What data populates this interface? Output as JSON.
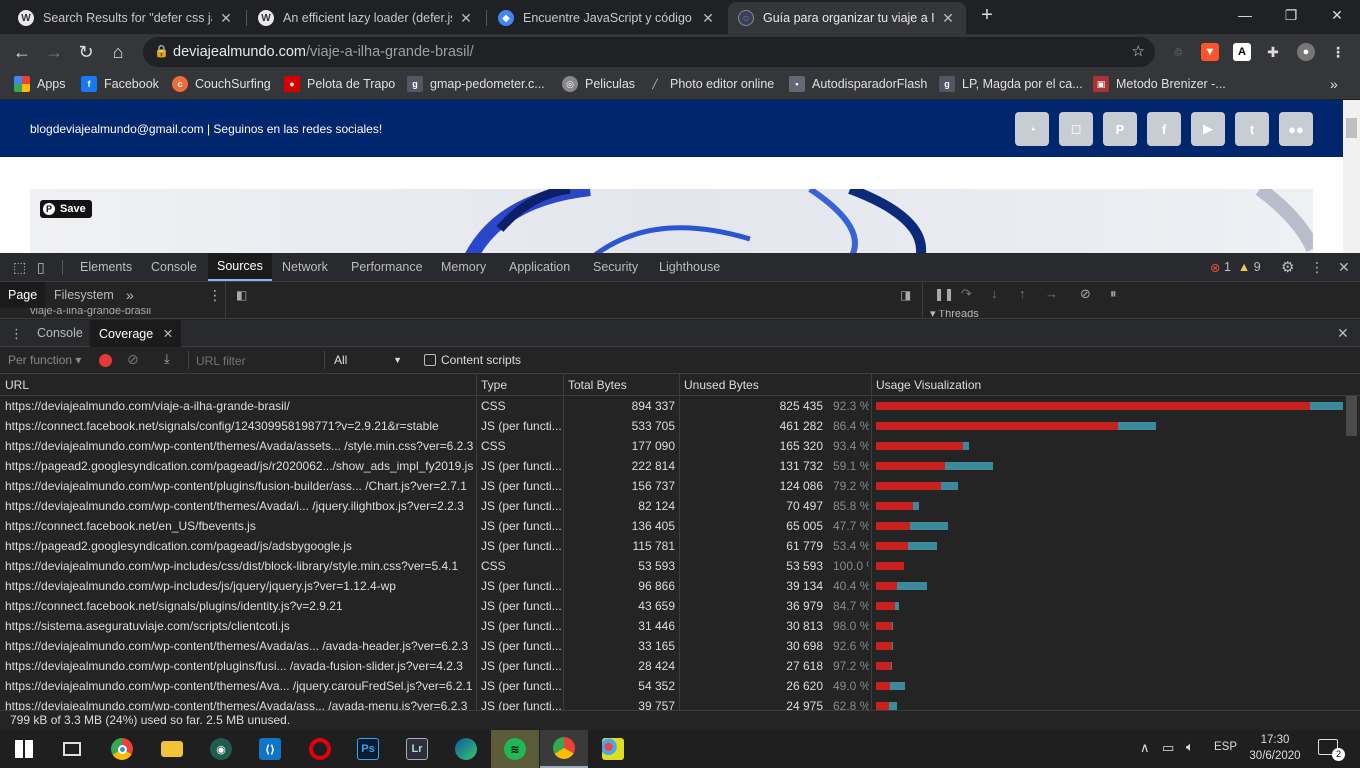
{
  "browser": {
    "tabs": [
      {
        "title": "Search Results for \"defer css javascript\"",
        "favicon": "wordpress-icon"
      },
      {
        "title": "An efficient lazy loader (defer.js)",
        "favicon": "wordpress-icon"
      },
      {
        "title": "Encuentre JavaScript y código CSS",
        "favicon": "chrome-devtools-icon"
      },
      {
        "title": "Guía para organizar tu viaje a Ilha Grande",
        "favicon": "site-icon"
      }
    ],
    "new_tab": "+",
    "url_host": "deviajealmundo.com",
    "url_path": "/viaje-a-ilha-grande-brasil/",
    "bookmarks": [
      {
        "label": "Apps",
        "color": "#e53935",
        "icon": "apps-icon"
      },
      {
        "label": "Facebook",
        "color": "#1877f2",
        "icon": "facebook-icon"
      },
      {
        "label": "CouchSurfing",
        "color": "#ed6b3a",
        "icon": "couchsurfing-icon"
      },
      {
        "label": "Pelota de Trapo",
        "color": "#d90000",
        "icon": "pelota-icon"
      },
      {
        "label": "gmap-pedometer.c...",
        "color": "#556",
        "icon": "gmap-icon"
      },
      {
        "label": "Peliculas",
        "color": "#888",
        "icon": "peliculas-icon"
      },
      {
        "label": "Photo editor online",
        "color": "#777",
        "icon": "photo-editor-icon"
      },
      {
        "label": "AutodisparadorFlash",
        "color": "#667",
        "icon": "flash-icon"
      },
      {
        "label": "LP, Magda por el ca...",
        "color": "#556",
        "icon": "lp-icon"
      },
      {
        "label": "Metodo Brenizer -...",
        "color": "#a33",
        "icon": "brenizer-icon"
      }
    ]
  },
  "site": {
    "topbar_text": "blogdeviajealmundo@gmail.com  |  Seguinos en las redes sociales!",
    "social_icons": [
      "rss-icon",
      "instagram-icon",
      "pinterest-icon",
      "facebook-icon",
      "youtube-icon",
      "twitter-icon",
      "flickr-icon"
    ],
    "pin_save": "Save"
  },
  "devtools": {
    "tabs": [
      "Elements",
      "Console",
      "Sources",
      "Network",
      "Performance",
      "Memory",
      "Application",
      "Security",
      "Lighthouse"
    ],
    "active_tab": "Sources",
    "errors": "1",
    "warnings": "9",
    "sources_tabs": [
      "Page",
      "Filesystem"
    ],
    "sources_tree_item": "viaje-a-ilha-grande-brasil",
    "threads_label": "Threads",
    "drawer_tabs": [
      "Console",
      "Coverage"
    ],
    "coverage": {
      "mode": "Per function",
      "url_filter_placeholder": "URL filter",
      "type_filter": "All",
      "content_scripts_label": "Content scripts",
      "columns": [
        "URL",
        "Type",
        "Total Bytes",
        "Unused Bytes",
        "Usage Visualization"
      ],
      "rows": [
        {
          "url": "https://deviajealmundo.com/viaje-a-ilha-grande-brasil/",
          "type": "CSS",
          "total": "894 337",
          "unused": "825 435",
          "pct": "92.3 %",
          "total_n": 894337,
          "unused_n": 825435
        },
        {
          "url": "https://connect.facebook.net/signals/config/124309958198771?v=2.9.21&r=stable",
          "type": "JS (per functi...",
          "total": "533 705",
          "unused": "461 282",
          "pct": "86.4 %",
          "total_n": 533705,
          "unused_n": 461282
        },
        {
          "url": "https://deviajealmundo.com/wp-content/themes/Avada/assets... /style.min.css?ver=6.2.3",
          "type": "CSS",
          "total": "177 090",
          "unused": "165 320",
          "pct": "93.4 %",
          "total_n": 177090,
          "unused_n": 165320
        },
        {
          "url": "https://pagead2.googlesyndication.com/pagead/js/r2020062.../show_ads_impl_fy2019.js",
          "type": "JS (per functi...",
          "total": "222 814",
          "unused": "131 732",
          "pct": "59.1 %",
          "total_n": 222814,
          "unused_n": 131732
        },
        {
          "url": "https://deviajealmundo.com/wp-content/plugins/fusion-builder/ass... /Chart.js?ver=2.7.1",
          "type": "JS (per functi...",
          "total": "156 737",
          "unused": "124 086",
          "pct": "79.2 %",
          "total_n": 156737,
          "unused_n": 124086
        },
        {
          "url": "https://deviajealmundo.com/wp-content/themes/Avada/i... /jquery.ilightbox.js?ver=2.2.3",
          "type": "JS (per functi...",
          "total": "82 124",
          "unused": "70 497",
          "pct": "85.8 %",
          "total_n": 82124,
          "unused_n": 70497
        },
        {
          "url": "https://connect.facebook.net/en_US/fbevents.js",
          "type": "JS (per functi...",
          "total": "136 405",
          "unused": "65 005",
          "pct": "47.7 %",
          "total_n": 136405,
          "unused_n": 65005
        },
        {
          "url": "https://pagead2.googlesyndication.com/pagead/js/adsbygoogle.js",
          "type": "JS (per functi...",
          "total": "115 781",
          "unused": "61 779",
          "pct": "53.4 %",
          "total_n": 115781,
          "unused_n": 61779
        },
        {
          "url": "https://deviajealmundo.com/wp-includes/css/dist/block-library/style.min.css?ver=5.4.1",
          "type": "CSS",
          "total": "53 593",
          "unused": "53 593",
          "pct": "100.0 %",
          "total_n": 53593,
          "unused_n": 53593
        },
        {
          "url": "https://deviajealmundo.com/wp-includes/js/jquery/jquery.js?ver=1.12.4-wp",
          "type": "JS (per functi...",
          "total": "96 866",
          "unused": "39 134",
          "pct": "40.4 %",
          "total_n": 96866,
          "unused_n": 39134
        },
        {
          "url": "https://connect.facebook.net/signals/plugins/identity.js?v=2.9.21",
          "type": "JS (per functi...",
          "total": "43 659",
          "unused": "36 979",
          "pct": "84.7 %",
          "total_n": 43659,
          "unused_n": 36979
        },
        {
          "url": "https://sistema.aseguratuviaje.com/scripts/clientcoti.js",
          "type": "JS (per functi...",
          "total": "31 446",
          "unused": "30 813",
          "pct": "98.0 %",
          "total_n": 31446,
          "unused_n": 30813
        },
        {
          "url": "https://deviajealmundo.com/wp-content/themes/Avada/as... /avada-header.js?ver=6.2.3",
          "type": "JS (per functi...",
          "total": "33 165",
          "unused": "30 698",
          "pct": "92.6 %",
          "total_n": 33165,
          "unused_n": 30698
        },
        {
          "url": "https://deviajealmundo.com/wp-content/plugins/fusi... /avada-fusion-slider.js?ver=4.2.3",
          "type": "JS (per functi...",
          "total": "28 424",
          "unused": "27 618",
          "pct": "97.2 %",
          "total_n": 28424,
          "unused_n": 27618
        },
        {
          "url": "https://deviajealmundo.com/wp-content/themes/Ava... /jquery.carouFredSel.js?ver=6.2.1",
          "type": "JS (per functi...",
          "total": "54 352",
          "unused": "26 620",
          "pct": "49.0 %",
          "total_n": 54352,
          "unused_n": 26620
        },
        {
          "url": "https://deviajealmundo.com/wp-content/themes/Avada/ass... /avada-menu.js?ver=6.2.3",
          "type": "JS (per functi...",
          "total": "39 757",
          "unused": "24 975",
          "pct": "62.8 %",
          "total_n": 39757,
          "unused_n": 24975
        }
      ],
      "status": "799 kB of 3.3 MB (24%) used so far. 2.5 MB unused."
    }
  },
  "taskbar": {
    "lang": "ESP",
    "time": "17:30",
    "date": "30/6/2020",
    "notifications": "2"
  },
  "colors": {
    "unused_bar": "#c9211e",
    "used_bar": "#3d8a9c",
    "site_header": "#00266e"
  }
}
